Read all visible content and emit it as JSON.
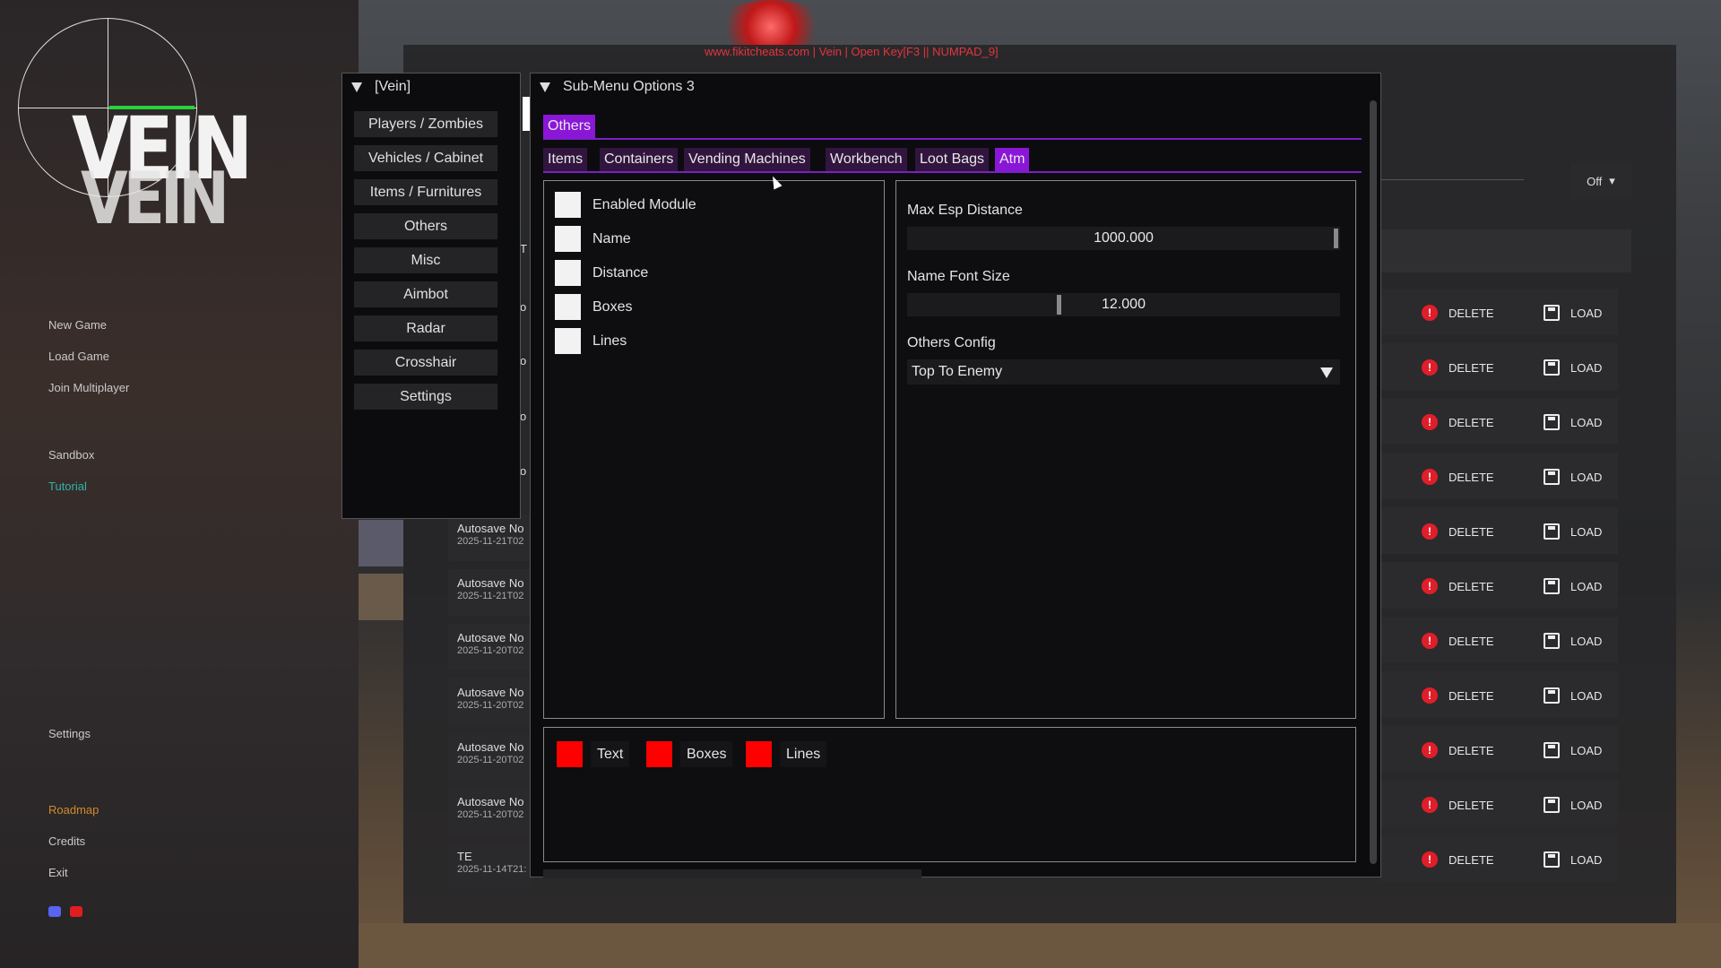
{
  "watermark": "www.fikitcheats.com | Vein | Open Key[F3 || NUMPAD_9]",
  "logo": {
    "text": "VEIN"
  },
  "game_menu": {
    "items": [
      {
        "label": "New Game",
        "color": "#c9c9c9"
      },
      {
        "label": "Load Game",
        "color": "#c9c9c9"
      },
      {
        "label": "Join Multiplayer",
        "color": "#c9c9c9"
      },
      {
        "label": "Sandbox",
        "color": "#c9c9c9"
      },
      {
        "label": "Tutorial",
        "color": "#2fb3a7"
      },
      {
        "label": "Settings",
        "color": "#c9c9c9"
      },
      {
        "label": "Roadmap",
        "color": "#d08a2a"
      },
      {
        "label": "Credits",
        "color": "#c9c9c9"
      },
      {
        "label": "Exit",
        "color": "#c9c9c9"
      }
    ],
    "social_icons": [
      "discord-icon",
      "youtube-icon"
    ]
  },
  "game_saves": {
    "dropdown_value": "Off",
    "partial_rows": [
      {
        "title": "Autosave No",
        "date": "2025-11-21T02"
      },
      {
        "title": "Autosave No",
        "date": "2025-11-21T02"
      },
      {
        "title": "Autosave No",
        "date": "2025-11-20T02"
      },
      {
        "title": "Autosave No",
        "date": "2025-11-20T02"
      },
      {
        "title": "Autosave No",
        "date": "2025-11-20T02"
      },
      {
        "title": "Autosave No",
        "date": "2025-11-20T02"
      },
      {
        "title": "TE",
        "date": "2025-11-14T21:"
      }
    ],
    "fragments": [
      "T",
      "o",
      "o",
      "o",
      "o"
    ],
    "delete_label": "DELETE",
    "load_label": "LOAD"
  },
  "vein_window": {
    "title": "[Vein]",
    "items": [
      "Players / Zombies",
      "Vehicles / Cabinet",
      "Items / Furnitures",
      "Others",
      "Misc",
      "Aimbot",
      "Radar",
      "Crosshair",
      "Settings"
    ]
  },
  "submenu_window": {
    "title": "Sub-Menu Options 3",
    "main_tab": "Others",
    "sub_tabs": [
      {
        "label": "Items",
        "active": false
      },
      {
        "label": "Containers",
        "active": false
      },
      {
        "label": "Vending Machines",
        "active": false
      },
      {
        "label": "Workbench",
        "active": false
      },
      {
        "label": "Loot Bags",
        "active": false
      },
      {
        "label": "Atm",
        "active": true
      }
    ],
    "checkboxes": [
      "Enabled Module",
      "Name",
      "Distance",
      "Boxes",
      "Lines"
    ],
    "max_esp_label": "Max Esp Distance",
    "max_esp_value": "1000.000",
    "max_esp_fraction": 1.0,
    "font_size_label": "Name Font Size",
    "font_size_value": "12.000",
    "font_size_fraction": 0.35,
    "config_label": "Others Config",
    "config_value": "Top To Enemy",
    "colors": [
      {
        "label": "Text",
        "color": "#ff0000"
      },
      {
        "label": "Boxes",
        "color": "#ff0000"
      },
      {
        "label": "Lines",
        "color": "#ff0000"
      }
    ]
  },
  "accent": "#8a16d8"
}
